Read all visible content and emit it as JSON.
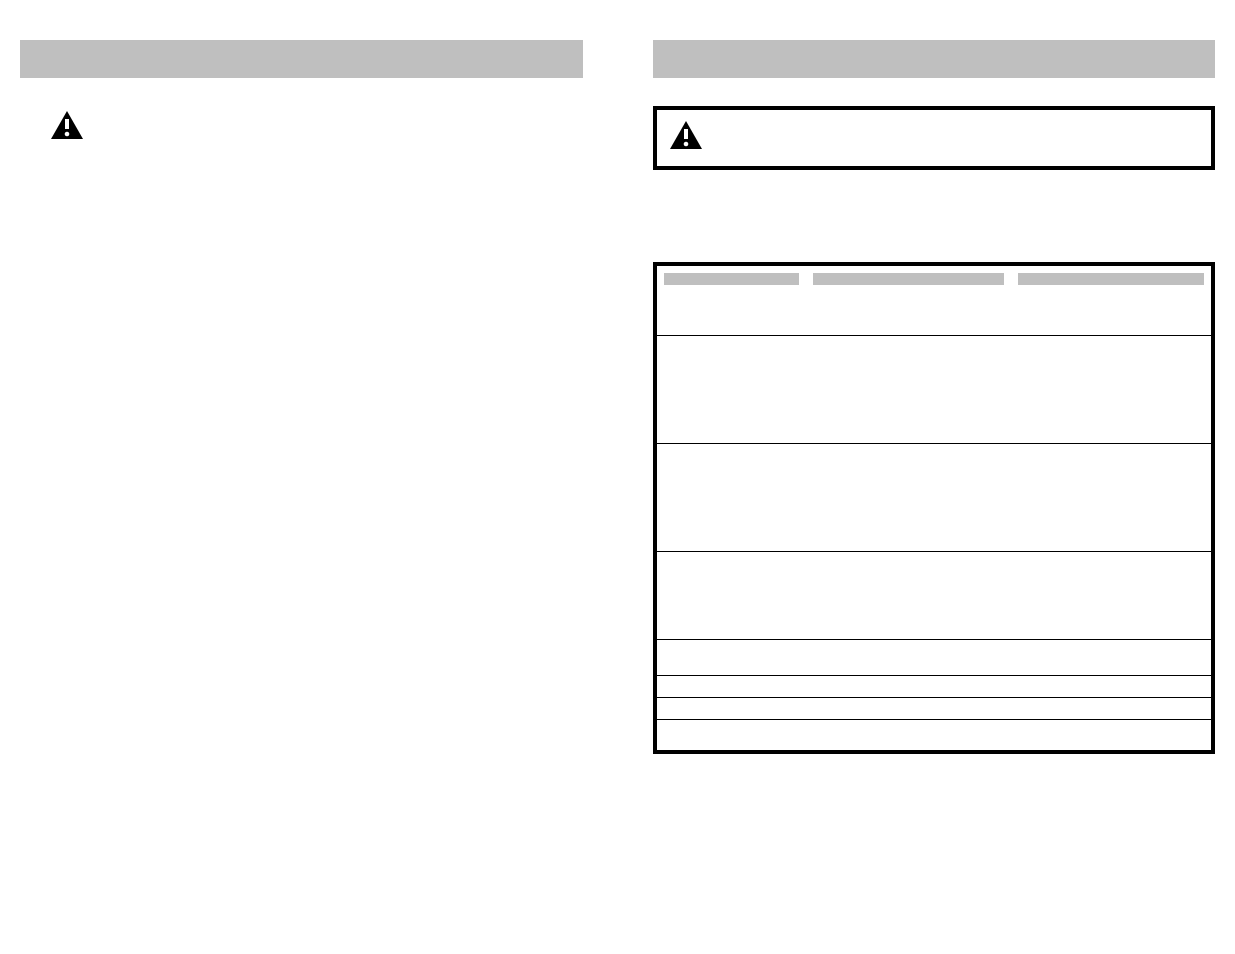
{
  "left": {
    "section_title": "",
    "warning_text": ""
  },
  "right": {
    "section_title": "",
    "boxed_warning_text": "",
    "table": {
      "headers": [
        "",
        "",
        ""
      ],
      "rows": [
        [
          "",
          "",
          ""
        ],
        [
          "",
          "",
          ""
        ],
        [
          "",
          "",
          ""
        ],
        [
          "",
          "",
          ""
        ],
        [
          "",
          "",
          ""
        ],
        [
          "",
          "",
          ""
        ],
        [
          "",
          "",
          ""
        ],
        [
          "",
          "",
          ""
        ]
      ]
    }
  }
}
